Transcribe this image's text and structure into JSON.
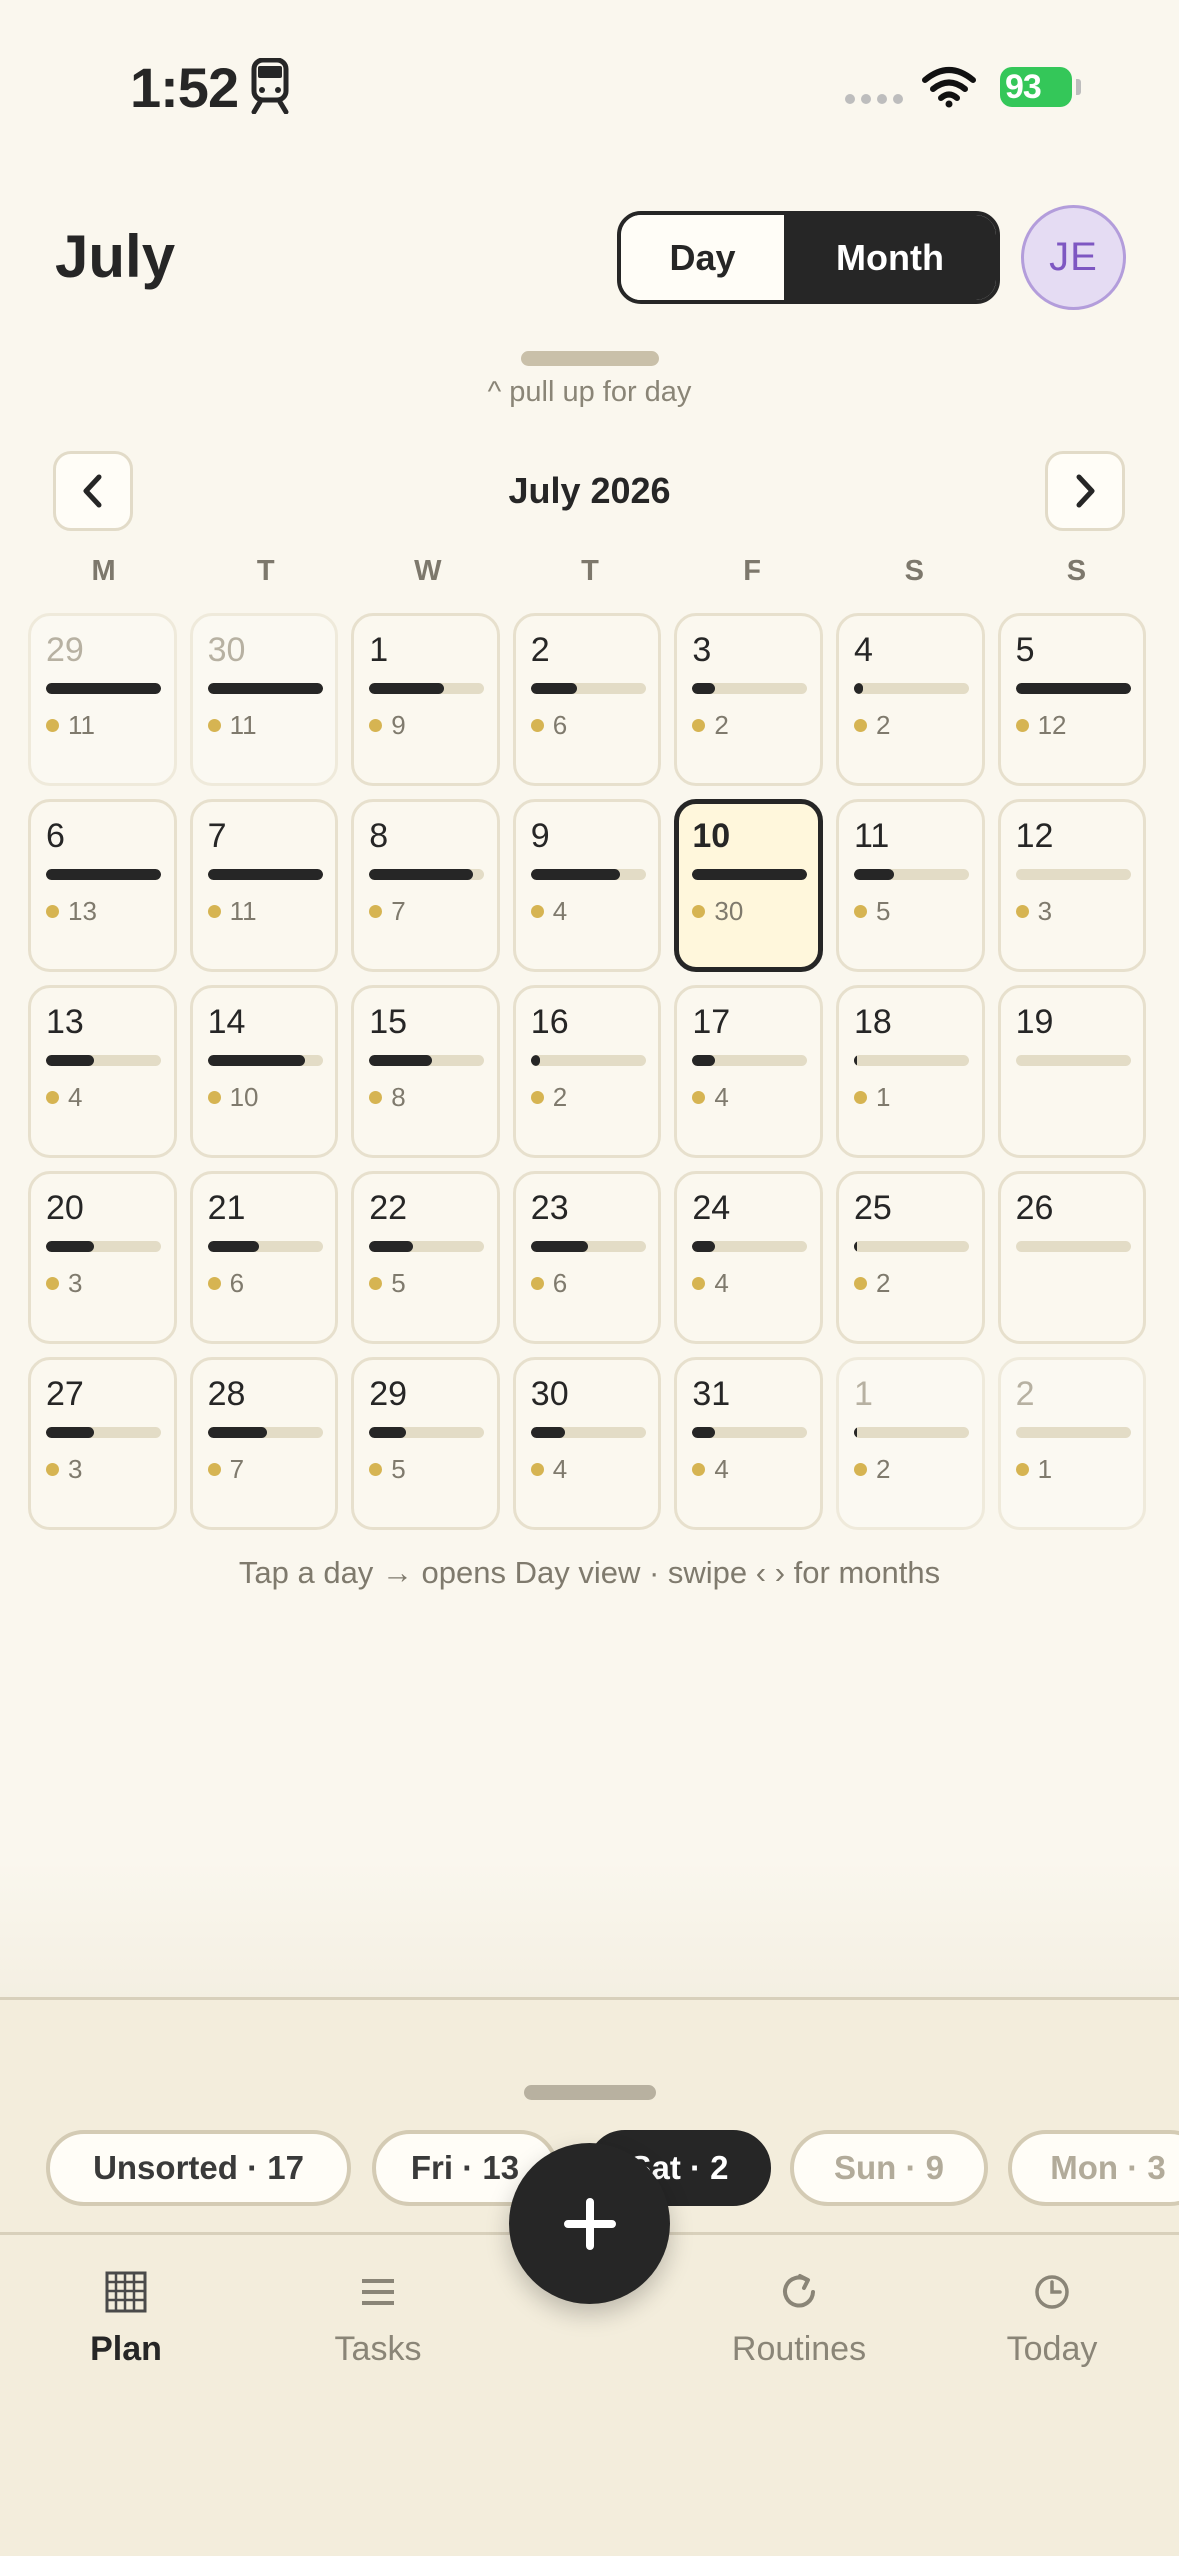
{
  "status_bar": {
    "time": "1:52",
    "battery": "93"
  },
  "header": {
    "title": "July",
    "view_toggle": {
      "day_label": "Day",
      "month_label": "Month",
      "selected": "Month"
    },
    "avatar_initials": "JE"
  },
  "pull_hint": "^ pull up for day",
  "calendar": {
    "month_label": "July 2026",
    "weekdays": [
      "M",
      "T",
      "W",
      "T",
      "F",
      "S",
      "S"
    ],
    "days": [
      {
        "label": "29",
        "in_month": false,
        "progress": 1.0,
        "count": "11"
      },
      {
        "label": "30",
        "in_month": false,
        "progress": 1.0,
        "count": "11"
      },
      {
        "label": "1",
        "in_month": true,
        "progress": 0.65,
        "count": "9"
      },
      {
        "label": "2",
        "in_month": true,
        "progress": 0.4,
        "count": "6"
      },
      {
        "label": "3",
        "in_month": true,
        "progress": 0.2,
        "count": "2"
      },
      {
        "label": "4",
        "in_month": true,
        "progress": 0.08,
        "count": "2"
      },
      {
        "label": "5",
        "in_month": true,
        "progress": 1.0,
        "count": "12"
      },
      {
        "label": "6",
        "in_month": true,
        "progress": 1.0,
        "count": "13"
      },
      {
        "label": "7",
        "in_month": true,
        "progress": 1.0,
        "count": "11"
      },
      {
        "label": "8",
        "in_month": true,
        "progress": 0.9,
        "count": "7"
      },
      {
        "label": "9",
        "in_month": true,
        "progress": 0.78,
        "count": "4"
      },
      {
        "label": "10",
        "in_month": true,
        "progress": 1.0,
        "count": "30",
        "selected": true
      },
      {
        "label": "11",
        "in_month": true,
        "progress": 0.35,
        "count": "5"
      },
      {
        "label": "12",
        "in_month": true,
        "progress": 0.0,
        "count": "3"
      },
      {
        "label": "13",
        "in_month": true,
        "progress": 0.42,
        "count": "4"
      },
      {
        "label": "14",
        "in_month": true,
        "progress": 0.85,
        "count": "10"
      },
      {
        "label": "15",
        "in_month": true,
        "progress": 0.55,
        "count": "8"
      },
      {
        "label": "16",
        "in_month": true,
        "progress": 0.08,
        "count": "2"
      },
      {
        "label": "17",
        "in_month": true,
        "progress": 0.2,
        "count": "4"
      },
      {
        "label": "18",
        "in_month": true,
        "progress": 0.03,
        "count": "1"
      },
      {
        "label": "19",
        "in_month": true,
        "progress": 0.0,
        "count": ""
      },
      {
        "label": "20",
        "in_month": true,
        "progress": 0.42,
        "count": "3"
      },
      {
        "label": "21",
        "in_month": true,
        "progress": 0.45,
        "count": "6"
      },
      {
        "label": "22",
        "in_month": true,
        "progress": 0.38,
        "count": "5"
      },
      {
        "label": "23",
        "in_month": true,
        "progress": 0.5,
        "count": "6"
      },
      {
        "label": "24",
        "in_month": true,
        "progress": 0.2,
        "count": "4"
      },
      {
        "label": "25",
        "in_month": true,
        "progress": 0.03,
        "count": "2"
      },
      {
        "label": "26",
        "in_month": true,
        "progress": 0.0,
        "count": ""
      },
      {
        "label": "27",
        "in_month": true,
        "progress": 0.42,
        "count": "3"
      },
      {
        "label": "28",
        "in_month": true,
        "progress": 0.52,
        "count": "7"
      },
      {
        "label": "29",
        "in_month": true,
        "progress": 0.32,
        "count": "5"
      },
      {
        "label": "30",
        "in_month": true,
        "progress": 0.3,
        "count": "4"
      },
      {
        "label": "31",
        "in_month": true,
        "progress": 0.2,
        "count": "4"
      },
      {
        "label": "1",
        "in_month": false,
        "progress": 0.03,
        "count": "2"
      },
      {
        "label": "2",
        "in_month": false,
        "progress": 0.0,
        "count": "1"
      }
    ]
  },
  "hint": "Tap a day → opens Day view · swipe ‹ › for months",
  "bucket_chips": [
    {
      "label": "Unsorted · 17",
      "state": "normal"
    },
    {
      "label": "Fri · 13",
      "state": "normal"
    },
    {
      "label": "Sat · 2",
      "state": "active"
    },
    {
      "label": "Sun · 9",
      "state": "dim"
    },
    {
      "label": "Mon · 3",
      "state": "dim"
    }
  ],
  "tabs": [
    {
      "label": "Plan",
      "icon": "calendar-grid-icon",
      "active": true
    },
    {
      "label": "Tasks",
      "icon": "list-icon",
      "active": false
    },
    {
      "label": "Routines",
      "icon": "repeat-icon",
      "active": false
    },
    {
      "label": "Today",
      "icon": "clock-icon",
      "active": false
    }
  ],
  "colors": {
    "background": "#faf7ee",
    "ink": "#262626",
    "accent_dot": "#d6b452",
    "selected_day": "#fff7dc",
    "battery": "#34c759",
    "avatar_bg": "#e5dcf3"
  }
}
